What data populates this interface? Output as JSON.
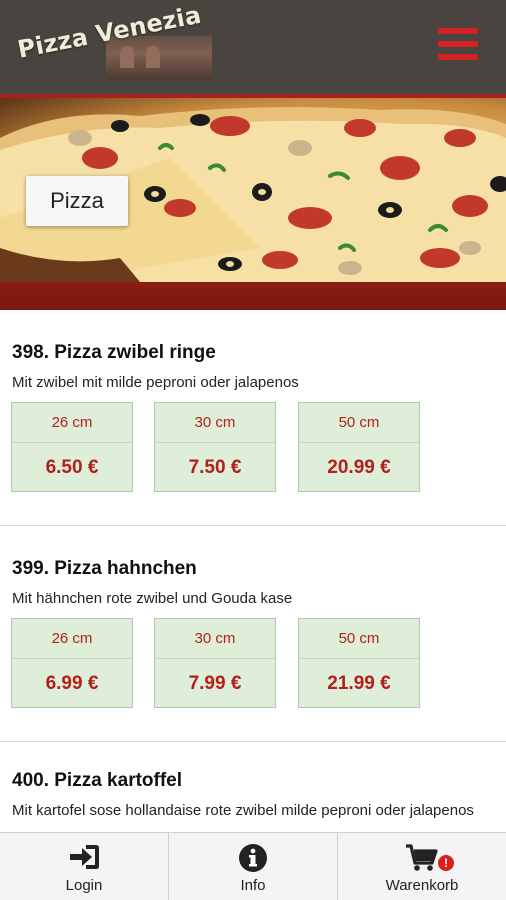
{
  "header": {
    "logo_text": "Pizza Venezia",
    "menu_icon": "hamburger-menu-icon",
    "colors": {
      "bar": "#4a4440",
      "accent": "#d42124"
    }
  },
  "hero": {
    "category_label": "Pizza"
  },
  "items": [
    {
      "title": "398. Pizza zwibel ringe",
      "description": "Mit zwibel mit milde peproni oder jalapenos",
      "prices": [
        {
          "size": "26 cm",
          "price": "6.50 €"
        },
        {
          "size": "30 cm",
          "price": "7.50 €"
        },
        {
          "size": "50 cm",
          "price": "20.99 €"
        }
      ]
    },
    {
      "title": "399. Pizza hahnchen",
      "description": "Mit hähnchen rote zwibel und Gouda kase",
      "prices": [
        {
          "size": "26 cm",
          "price": "6.99 €"
        },
        {
          "size": "30 cm",
          "price": "7.99 €"
        },
        {
          "size": "50 cm",
          "price": "21.99 €"
        }
      ]
    },
    {
      "title": "400. Pizza kartoffel",
      "description": "Mit kartofel sose hollandaise rote zwibel milde peproni oder jalapenos",
      "prices": []
    }
  ],
  "tabbar": {
    "tabs": [
      {
        "label": "Login",
        "icon": "sign-in-icon"
      },
      {
        "label": "Info",
        "icon": "info-icon"
      },
      {
        "label": "Warenkorb",
        "icon": "shopping-cart-icon",
        "badge": "!"
      }
    ]
  }
}
